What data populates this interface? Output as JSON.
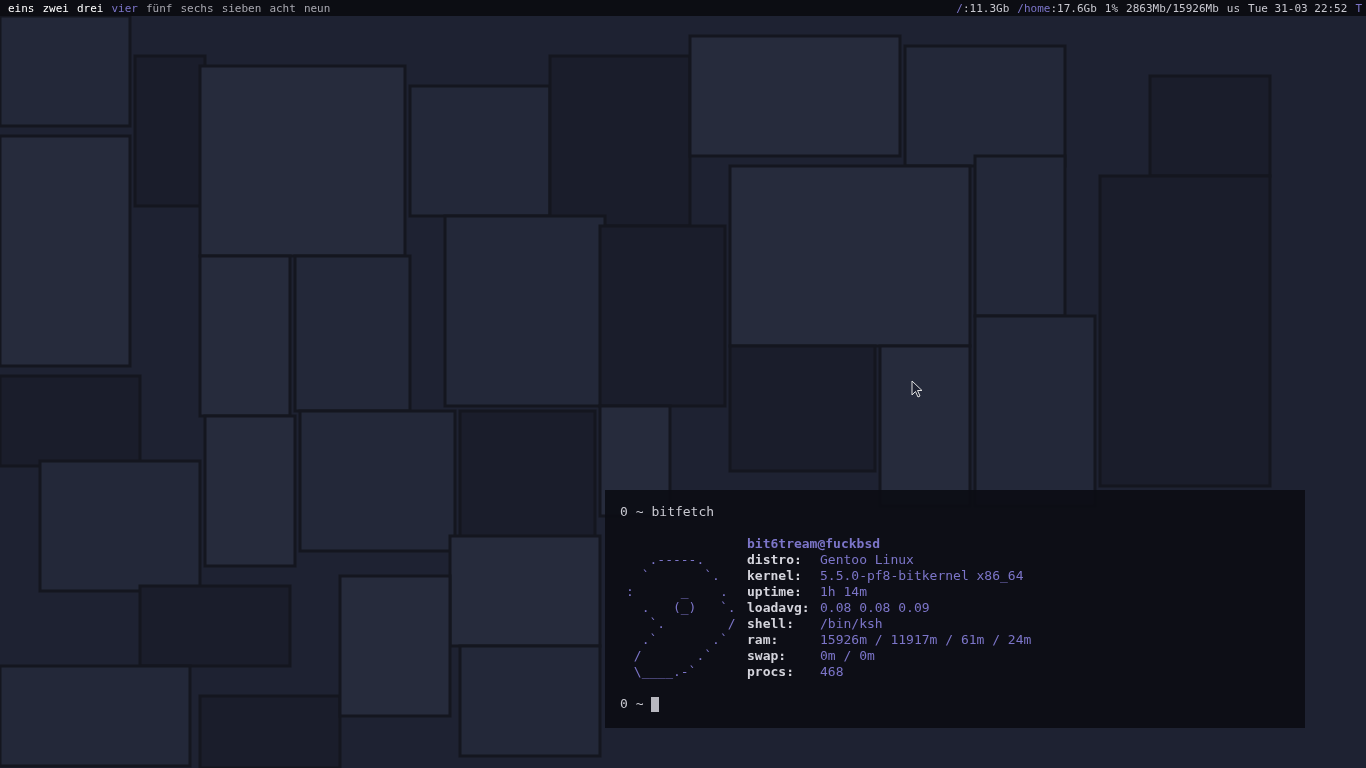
{
  "top_bar": {
    "workspaces": [
      {
        "label": "eins",
        "selected": false,
        "occupied": true
      },
      {
        "label": "zwei",
        "selected": false,
        "occupied": true
      },
      {
        "label": "drei",
        "selected": false,
        "occupied": true
      },
      {
        "label": "vier",
        "selected": true,
        "occupied": false
      },
      {
        "label": "fünf",
        "selected": false,
        "occupied": false
      },
      {
        "label": "sechs",
        "selected": false,
        "occupied": false
      },
      {
        "label": "sieben",
        "selected": false,
        "occupied": false
      },
      {
        "label": "acht",
        "selected": false,
        "occupied": false
      },
      {
        "label": "neun",
        "selected": false,
        "occupied": false
      }
    ],
    "status": [
      {
        "kind": "disk",
        "label": "/",
        "value": ":11.3Gb"
      },
      {
        "kind": "disk",
        "label": "/home",
        "value": ":17.6Gb"
      },
      {
        "kind": "plain",
        "value": "1%"
      },
      {
        "kind": "plain",
        "value": "2863Mb/15926Mb"
      },
      {
        "kind": "plain",
        "value": "us"
      },
      {
        "kind": "plain",
        "value": "Tue 31-03 22:52"
      },
      {
        "kind": "accent",
        "value": "T"
      }
    ]
  },
  "terminal": {
    "command_prompt": "0 ~",
    "command": "bitfetch",
    "user_host": "bit6tream@fuckbsd",
    "logo_lines": [
      "   .-----.",
      "  `       `.",
      ":      _    .",
      "  .   (_)   `.",
      "   `.        /",
      "  .`       .`",
      " /       .`",
      " \\____.-`"
    ],
    "info": [
      {
        "key": "distro:",
        "value": "Gentoo Linux"
      },
      {
        "key": "kernel:",
        "value": "5.5.0-pf8-bitkernel x86_64"
      },
      {
        "key": "uptime:",
        "value": "1h 14m"
      },
      {
        "key": "loadavg:",
        "value": "0.08 0.08 0.09"
      },
      {
        "key": "shell:",
        "value": "/bin/ksh"
      },
      {
        "key": "ram:",
        "value": "15926m / 11917m / 61m / 24m"
      },
      {
        "key": "swap:",
        "value": "0m / 0m"
      },
      {
        "key": "procs:",
        "value": "468"
      }
    ],
    "input_prompt": "0 ~"
  }
}
